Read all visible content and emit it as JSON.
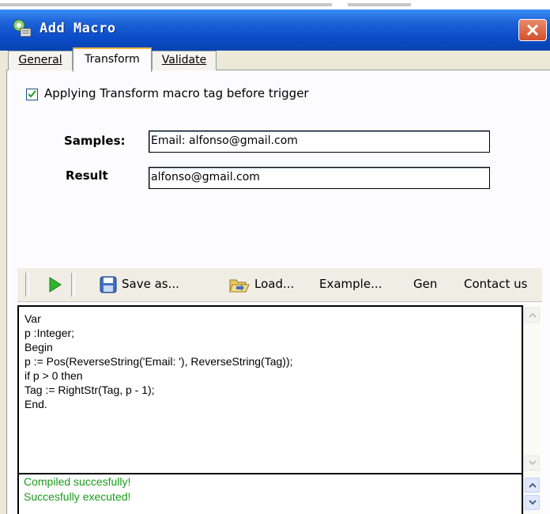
{
  "window": {
    "title": "Add Macro",
    "close_icon": "close-icon",
    "app_icon": "macro-app-icon"
  },
  "tabs": [
    {
      "label": "General",
      "active": false
    },
    {
      "label": "Transform",
      "active": true
    },
    {
      "label": "Validate",
      "active": false
    }
  ],
  "options": {
    "apply_transform_label": "Applying Transform macro tag before trigger",
    "apply_transform_checked": true
  },
  "samples": {
    "label": "Samples:",
    "value": "Email: alfonso@gmail.com"
  },
  "result": {
    "label": "Result",
    "value": "alfonso@gmail.com"
  },
  "toolbar": {
    "run_icon": "play-icon",
    "save_icon": "floppy-disk-icon",
    "save_label": "Save as...",
    "load_icon": "folder-open-icon",
    "load_label": "Load...",
    "example_label": "Example...",
    "gen_label": "Gen",
    "contact_label": "Contact us"
  },
  "editor": {
    "lines": [
      "Var",
      "p :Integer;",
      "Begin",
      "p := Pos(ReverseString('Email: '), ReverseString(Tag));",
      "if p > 0 then",
      "Tag := RightStr(Tag, p - 1);",
      "End."
    ]
  },
  "log": {
    "lines": [
      "Compiled succesfully!",
      "Succesfully executed!"
    ],
    "color": "#1a9b1a"
  },
  "colors": {
    "titlebar": "#0a4cc8",
    "close": "#d4502c",
    "tab_highlight": "#f6b240",
    "run_green": "#2fb52f"
  }
}
